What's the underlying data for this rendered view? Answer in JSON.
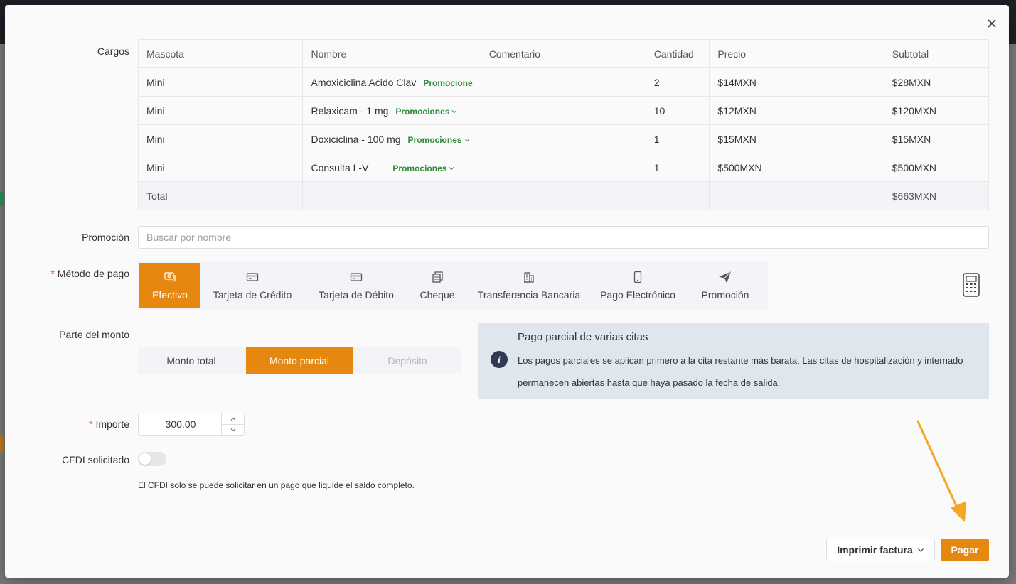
{
  "labels": {
    "cargos": "Cargos",
    "promocion": "Promoción",
    "metodo_pago": "Método de pago",
    "parte_monto": "Parte del monto",
    "importe": "Importe",
    "cfdi": "CFDI solicitado",
    "required_mark": "*"
  },
  "table": {
    "headers": [
      "Mascota",
      "Nombre",
      "Comentario",
      "Cantidad",
      "Precio",
      "Subtotal"
    ],
    "rows": [
      {
        "mascota": "Mini",
        "nombre": "Amoxiciclina Acido Clav",
        "promo": "Promocione",
        "comentario": "",
        "cantidad": "2",
        "precio": "$14MXN",
        "subtotal": "$28MXN"
      },
      {
        "mascota": "Mini",
        "nombre": "Relaxicam - 1 mg",
        "promo": "Promociones",
        "comentario": "",
        "cantidad": "10",
        "precio": "$12MXN",
        "subtotal": "$120MXN"
      },
      {
        "mascota": "Mini",
        "nombre": "Doxiciclina - 100 mg",
        "promo": "Promociones",
        "comentario": "",
        "cantidad": "1",
        "precio": "$15MXN",
        "subtotal": "$15MXN"
      },
      {
        "mascota": "Mini",
        "nombre": "Consulta L-V",
        "promo": "Promociones",
        "comentario": "",
        "cantidad": "1",
        "precio": "$500MXN",
        "subtotal": "$500MXN"
      }
    ],
    "total_label": "Total",
    "total_value": "$663MXN"
  },
  "search": {
    "placeholder": "Buscar por nombre",
    "value": ""
  },
  "payment_methods": [
    {
      "label": "Efectivo",
      "icon": "cash-icon",
      "active": true
    },
    {
      "label": "Tarjeta de Crédito",
      "icon": "credit-card-icon",
      "active": false
    },
    {
      "label": "Tarjeta de Débito",
      "icon": "debit-card-icon",
      "active": false
    },
    {
      "label": "Cheque",
      "icon": "cheque-icon",
      "active": false
    },
    {
      "label": "Transferencia Bancaria",
      "icon": "bank-icon",
      "active": false
    },
    {
      "label": "Pago Electrónico",
      "icon": "mobile-icon",
      "active": false
    },
    {
      "label": "Promoción",
      "icon": "send-icon",
      "active": false
    }
  ],
  "amount_part": {
    "options": [
      "Monto total",
      "Monto parcial",
      "Depósito"
    ],
    "selected": "Monto parcial"
  },
  "info": {
    "title": "Pago parcial de varias citas",
    "text": "Los pagos parciales se aplican primero a la cita restante más barata. Las citas de hospitalización y internado permanecen abiertas hasta que haya pasado la fecha de salida."
  },
  "importe": {
    "value": "300.00"
  },
  "cfdi": {
    "enabled": false,
    "note": "El CFDI solo se puede solicitar en un pago que liquide el saldo completo."
  },
  "buttons": {
    "print": "Imprimir factura",
    "pay": "Pagar"
  },
  "colors": {
    "accent": "#e6880f",
    "promo": "#2e8b3a",
    "info_bg": "#dfe6ee",
    "arrow": "#f5a623"
  }
}
